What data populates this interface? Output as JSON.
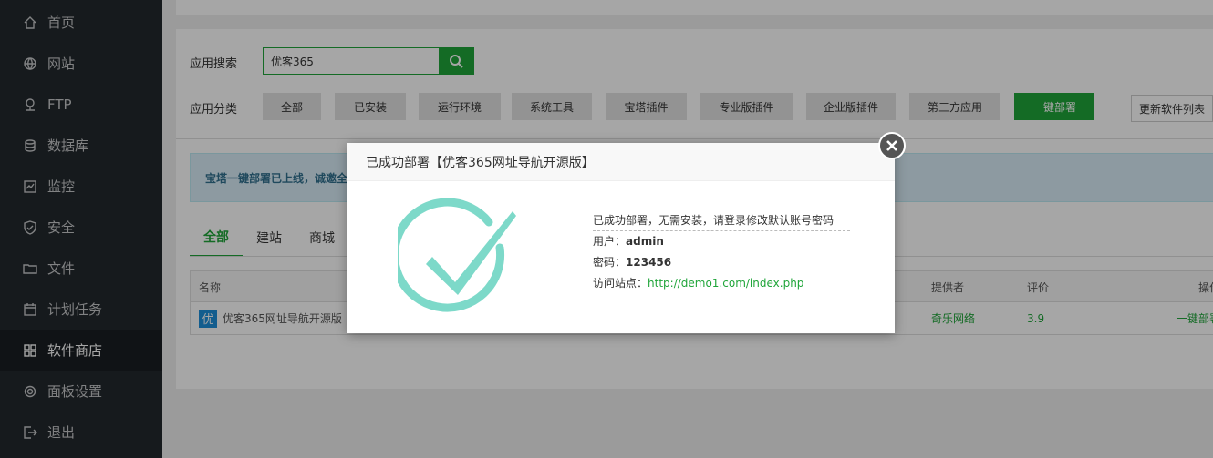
{
  "sidebar": {
    "items": [
      {
        "label": "首页",
        "icon": "home-icon"
      },
      {
        "label": "网站",
        "icon": "globe-icon"
      },
      {
        "label": "FTP",
        "icon": "ftp-icon"
      },
      {
        "label": "数据库",
        "icon": "database-icon"
      },
      {
        "label": "监控",
        "icon": "monitor-icon"
      },
      {
        "label": "安全",
        "icon": "shield-icon"
      },
      {
        "label": "文件",
        "icon": "folder-icon"
      },
      {
        "label": "计划任务",
        "icon": "calendar-icon"
      },
      {
        "label": "软件商店",
        "icon": "grid-icon",
        "active": true
      },
      {
        "label": "面板设置",
        "icon": "gear-icon"
      },
      {
        "label": "退出",
        "icon": "logout-icon"
      }
    ]
  },
  "store": {
    "search_label": "应用搜索",
    "search_value": "优客365",
    "category_label": "应用分类",
    "categories": [
      "全部",
      "已安装",
      "运行环境",
      "系统工具",
      "宝塔插件",
      "专业版插件",
      "企业版插件",
      "第三方应用",
      "一键部署"
    ],
    "active_category": "一键部署",
    "refresh_label": "更新软件列表",
    "notice": "宝塔一键部署已上线，诚邀全",
    "tabs": [
      "全部",
      "建站",
      "商城"
    ],
    "table": {
      "headers": {
        "name": "名称",
        "provider": "提供者",
        "rating": "评价",
        "action": "操作"
      },
      "rows": [
        {
          "icon_char": "优",
          "name": "优客365网址导航开源版",
          "provider": "奇乐网络",
          "rating": "3.9",
          "action": "一键部署"
        }
      ]
    }
  },
  "dialog": {
    "title": "已成功部署【优客365网址导航开源版】",
    "message": "已成功部署，无需安装，请登录修改默认账号密码",
    "user_label": "用户：",
    "user_value": "admin",
    "password_label": "密码：",
    "password_value": "123456",
    "site_label": "访问站点：",
    "site_url": "http://demo1.com/index.php"
  },
  "colors": {
    "accent": "#20a53a",
    "check": "#7dd9c9",
    "sidebar": "#23282d"
  }
}
